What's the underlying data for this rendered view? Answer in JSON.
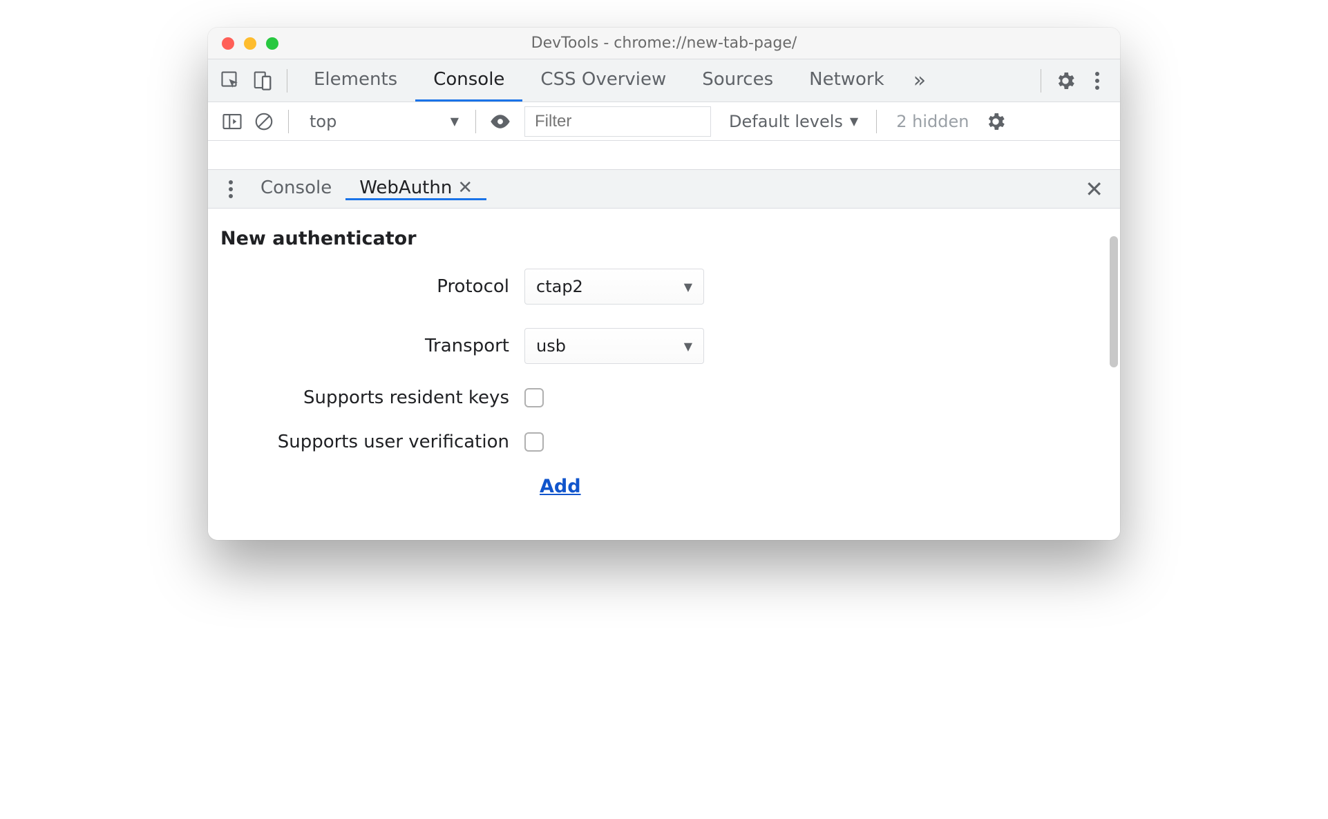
{
  "window": {
    "title": "DevTools - chrome://new-tab-page/"
  },
  "main_tabs": {
    "items": [
      "Elements",
      "Console",
      "CSS Overview",
      "Sources",
      "Network"
    ],
    "active_index": 1,
    "overflow_glyph": "»"
  },
  "console_toolbar": {
    "context": "top",
    "filter_placeholder": "Filter",
    "levels_label": "Default levels",
    "hidden_label": "2 hidden"
  },
  "drawer_tabs": {
    "items": [
      "Console",
      "WebAuthn"
    ],
    "active_index": 1,
    "close_glyph": "✕"
  },
  "webauthn": {
    "section_title": "New authenticator",
    "protocol_label": "Protocol",
    "protocol_value": "ctap2",
    "transport_label": "Transport",
    "transport_value": "usb",
    "resident_keys_label": "Supports resident keys",
    "user_verification_label": "Supports user verification",
    "add_label": "Add"
  }
}
